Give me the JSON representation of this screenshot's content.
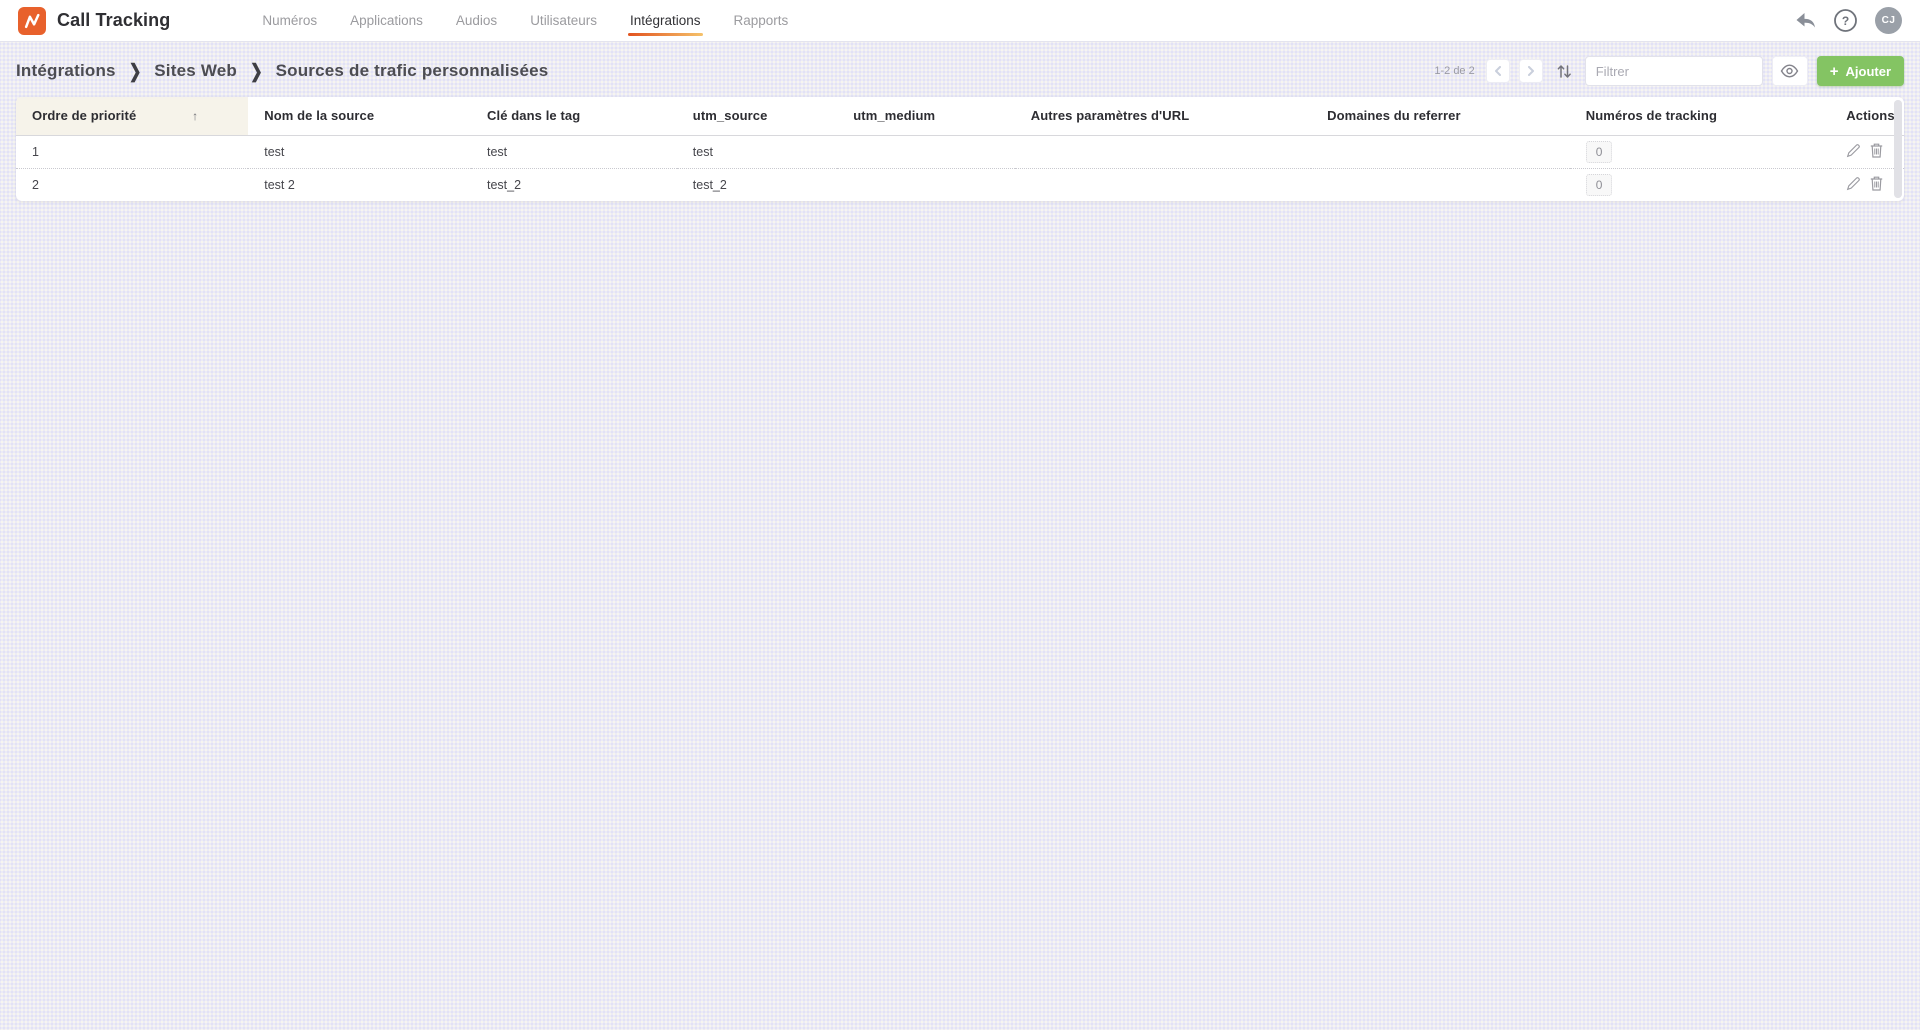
{
  "app": {
    "title": "Call Tracking",
    "accent_color": "#e8612c"
  },
  "topnav": {
    "items": [
      {
        "label": "Numéros",
        "active": false
      },
      {
        "label": "Applications",
        "active": false
      },
      {
        "label": "Audios",
        "active": false
      },
      {
        "label": "Utilisateurs",
        "active": false
      },
      {
        "label": "Intégrations",
        "active": true
      },
      {
        "label": "Rapports",
        "active": false
      }
    ]
  },
  "user": {
    "avatar_initials": "CJ"
  },
  "breadcrumb": {
    "items": [
      "Intégrations",
      "Sites Web",
      "Sources de trafic personnalisées"
    ],
    "separator": "❯"
  },
  "toolbar": {
    "range_text": "1-2 de 2",
    "prev_icon": "chevron-left",
    "next_icon": "chevron-right",
    "sort_icon": "arrows-up-down",
    "filter_placeholder": "Filtrer",
    "eye_icon": "eye",
    "add_button": {
      "plus": "+",
      "label": "Ajouter",
      "color": "#84c463"
    }
  },
  "table": {
    "columns": [
      "Ordre de priorité",
      "Nom de la source",
      "Clé dans le tag",
      "utm_source",
      "utm_medium",
      "Autres paramètres d'URL",
      "Domaines du referrer",
      "Numéros de tracking",
      "Actions"
    ],
    "sort": {
      "column": "Ordre de priorité",
      "direction": "asc",
      "icon": "↑"
    },
    "rows": [
      {
        "ordre": "1",
        "nom": "test",
        "cle": "test",
        "utm_source": "test",
        "utm_medium": "",
        "autres_parametres": "",
        "domaines": "",
        "numeros": "0"
      },
      {
        "ordre": "2",
        "nom": "test 2",
        "cle": "test_2",
        "utm_source": "test_2",
        "utm_medium": "",
        "autres_parametres": "",
        "domaines": "",
        "numeros": "0"
      }
    ]
  }
}
